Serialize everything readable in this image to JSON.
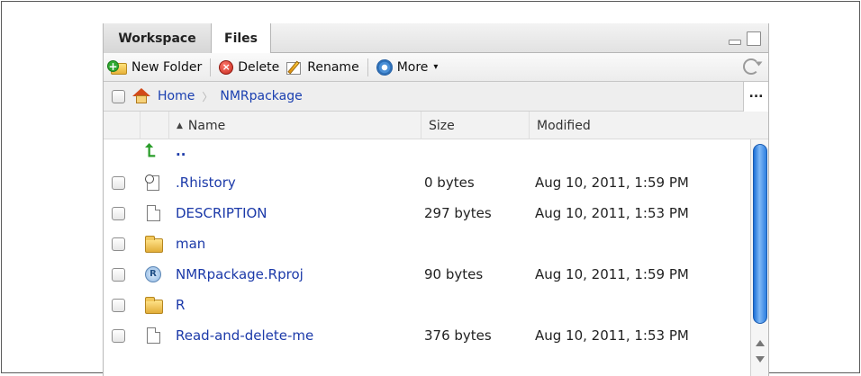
{
  "tabs": [
    {
      "label": "Workspace",
      "active": false
    },
    {
      "label": "Files",
      "active": true
    }
  ],
  "toolbar": {
    "new_folder": "New Folder",
    "delete": "Delete",
    "rename": "Rename",
    "more": "More"
  },
  "breadcrumb": {
    "home": "Home",
    "current": "NMRpackage",
    "more": "..."
  },
  "columns": {
    "name": "Name",
    "size": "Size",
    "modified": "Modified"
  },
  "parent_link": "..",
  "files": [
    {
      "name": ".Rhistory",
      "size": "0 bytes",
      "modified": "Aug 10, 2011, 1:59 PM",
      "icon": "history-file-icon"
    },
    {
      "name": "DESCRIPTION",
      "size": "297 bytes",
      "modified": "Aug 10, 2011, 1:53 PM",
      "icon": "text-file-icon"
    },
    {
      "name": "man",
      "size": "",
      "modified": "",
      "icon": "folder-icon"
    },
    {
      "name": "NMRpackage.Rproj",
      "size": "90 bytes",
      "modified": "Aug 10, 2011, 1:59 PM",
      "icon": "rproject-file-icon"
    },
    {
      "name": "R",
      "size": "",
      "modified": "",
      "icon": "folder-icon"
    },
    {
      "name": "Read-and-delete-me",
      "size": "376 bytes",
      "modified": "Aug 10, 2011, 1:53 PM",
      "icon": "text-file-icon"
    }
  ],
  "colors": {
    "link": "#1c3aa9",
    "scroll_thumb": "#2d7fe0"
  }
}
